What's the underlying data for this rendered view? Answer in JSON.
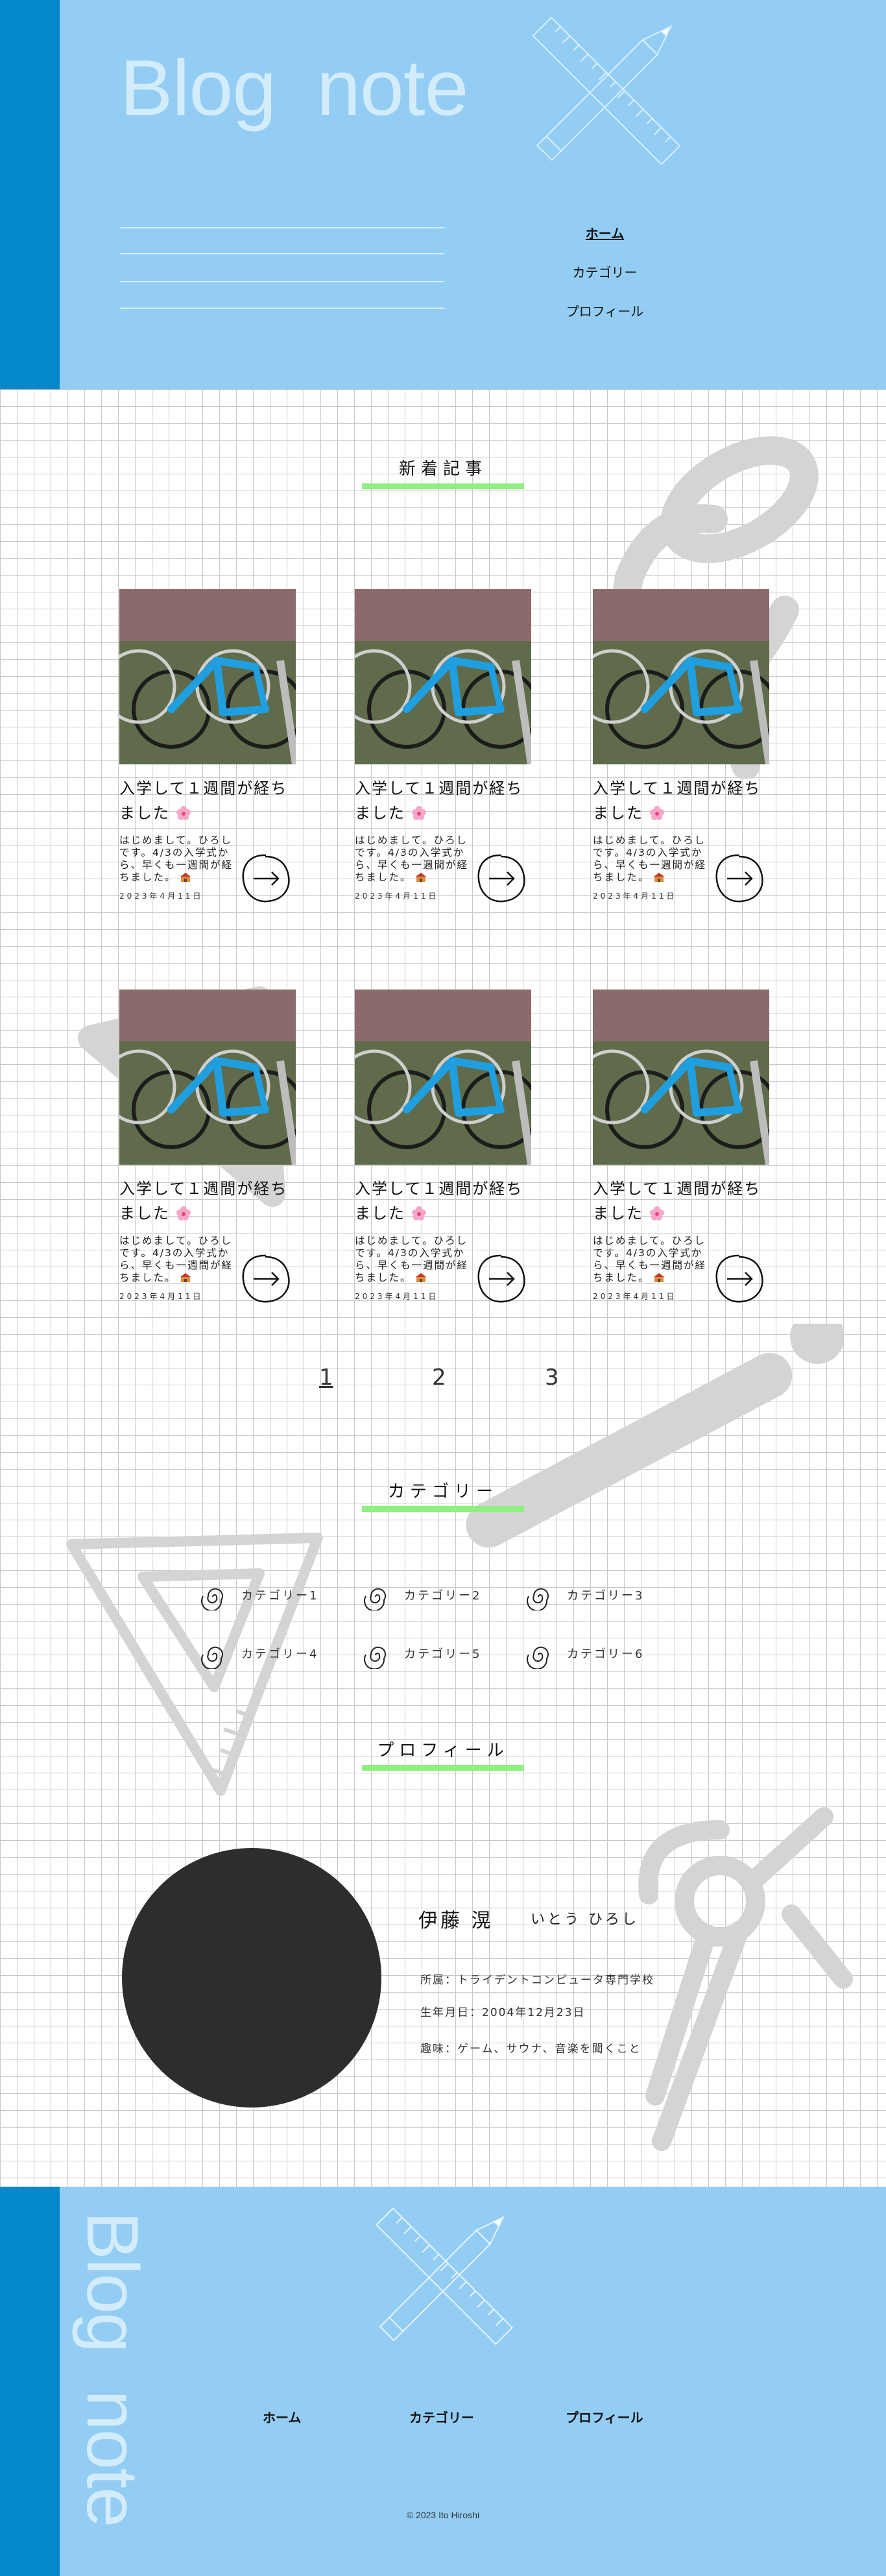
{
  "site": {
    "logo": "Blog note"
  },
  "nav": {
    "home": "ホーム",
    "category": "カテゴリー",
    "profile": "プロフィール"
  },
  "sections": {
    "new_posts": "新着記事",
    "categories": "カテゴリー",
    "profile": "プロフィール"
  },
  "posts": [
    {
      "title": "入学して１週間が経ちました",
      "excerpt": "はじめまして。ひろしです。4/3の入学式から、早くも一週間が経ちました。",
      "date": "2023年4月11日"
    },
    {
      "title": "入学して１週間が経ちました",
      "excerpt": "はじめまして。ひろしです。4/3の入学式から、早くも一週間が経ちました。",
      "date": "2023年4月11日"
    },
    {
      "title": "入学して１週間が経ちました",
      "excerpt": "はじめまして。ひろしです。4/3の入学式から、早くも一週間が経ちました。",
      "date": "2023年4月11日"
    },
    {
      "title": "入学して１週間が経ちました",
      "excerpt": "はじめまして。ひろしです。4/3の入学式から、早くも一週間が経ちました。",
      "date": "2023年4月11日"
    },
    {
      "title": "入学して１週間が経ちました",
      "excerpt": "はじめまして。ひろしです。4/3の入学式から、早くも一週間が経ちました。",
      "date": "2023年4月11日"
    },
    {
      "title": "入学して１週間が経ちました",
      "excerpt": "はじめまして。ひろしです。4/3の入学式から、早くも一週間が経ちました。",
      "date": "2023年4月11日"
    }
  ],
  "pagination": [
    "1",
    "2",
    "3"
  ],
  "categories": [
    "カテゴリー1",
    "カテゴリー2",
    "カテゴリー3",
    "カテゴリー4",
    "カテゴリー5",
    "カテゴリー6"
  ],
  "profile": {
    "name": "伊藤 滉",
    "kana": "いとう ひろし",
    "affiliation": "所属：トライデントコンピュータ専門学校",
    "birthday": "生年月日：2004年12月23日",
    "hobby": "趣味：ゲーム、サウナ、音楽を聞くこと"
  },
  "footer": {
    "copyright": "© 2023 Ito Hiroshi"
  },
  "colors": {
    "header_bg": "#93cdf3",
    "strip": "#0587cc",
    "accent_bar": "#8ef07e",
    "avatar": "#2d2d2d"
  }
}
